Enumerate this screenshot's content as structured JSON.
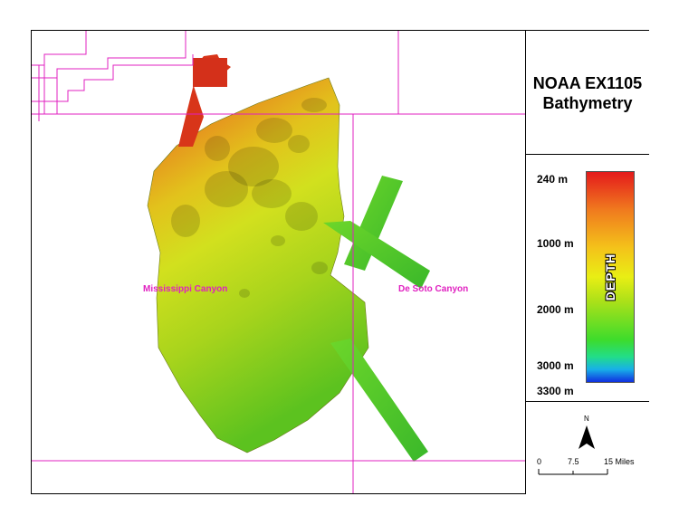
{
  "title": {
    "line1": "NOAA EX1105",
    "line2": "Bathymetry"
  },
  "legend": {
    "bar_label": "DEPTH",
    "ticks": [
      "240 m",
      "1000 m",
      "2000 m",
      "3000 m",
      "3300 m"
    ],
    "colors": {
      "shallow": "#e41a1c",
      "mid_shallow": "#f07a1e",
      "mid": "#e9ee14",
      "deep": "#3ddc2c",
      "deepest": "#1030e0"
    }
  },
  "places": {
    "left": "Mississippi Canyon",
    "right": "De Soto Canyon"
  },
  "scale_bar": {
    "zero": "0",
    "mid": "7.5",
    "end": "15 Miles"
  },
  "north_arrow": {
    "label": "N",
    "icon": "north-arrow-icon"
  },
  "grid_color": "#e020c0"
}
